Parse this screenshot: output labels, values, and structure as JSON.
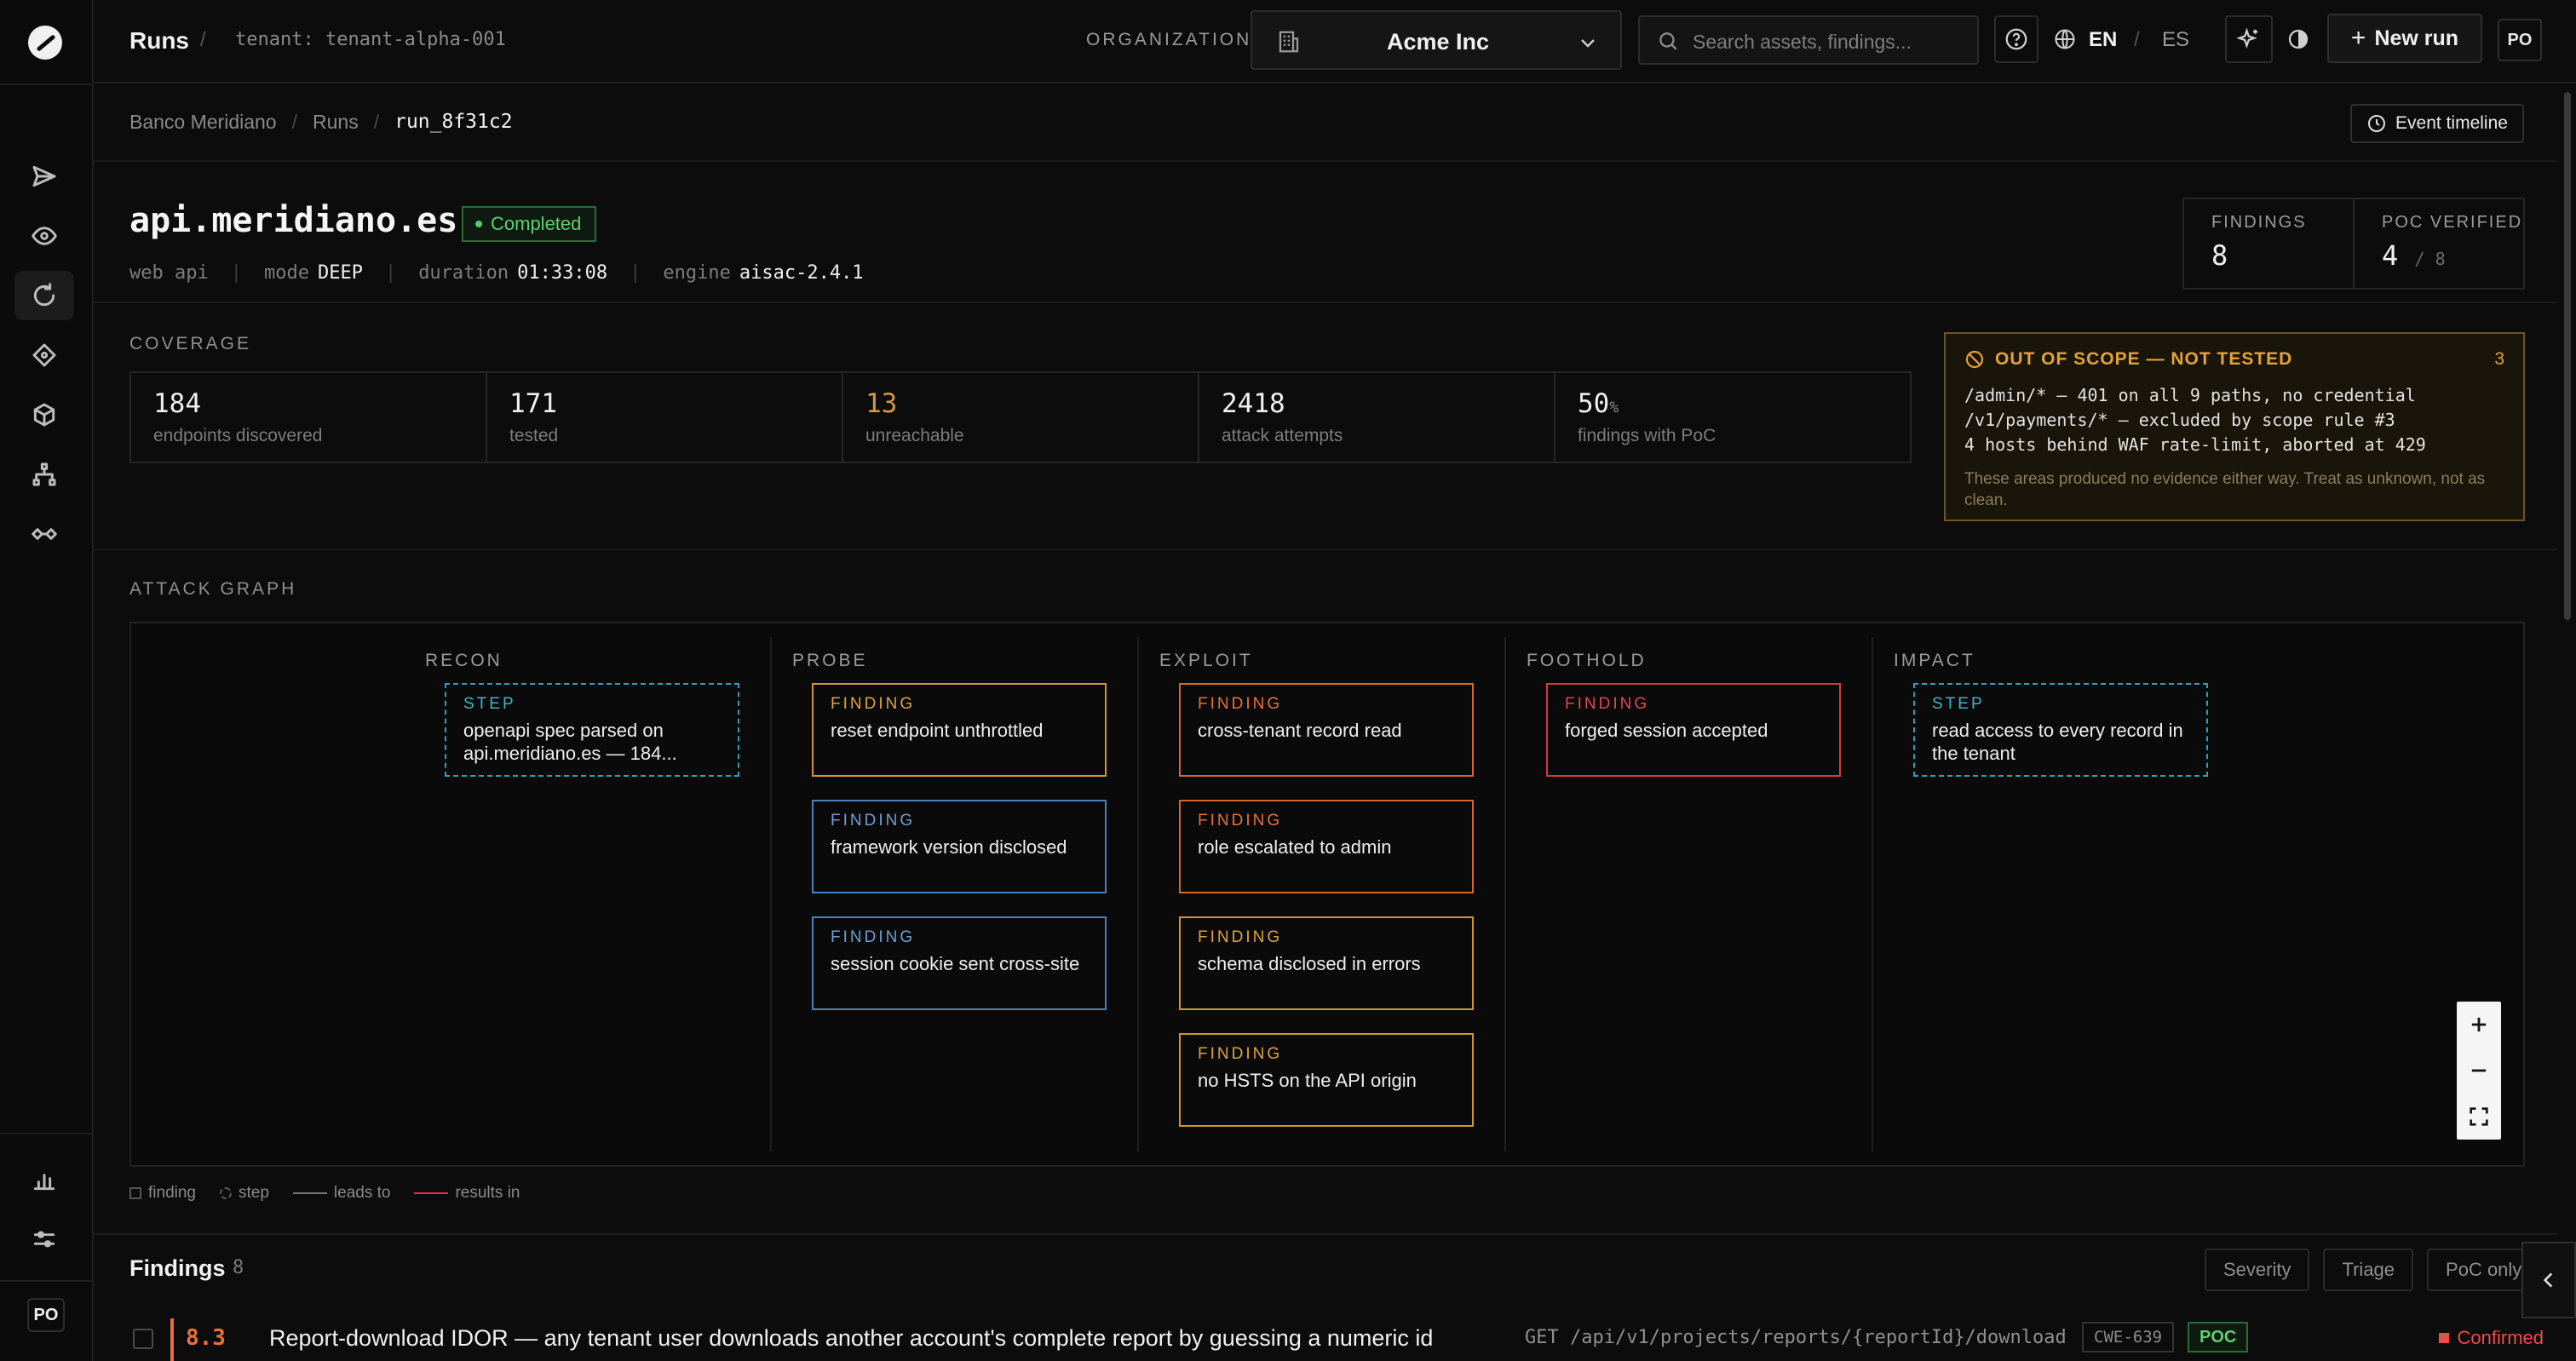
{
  "topbar": {
    "title": "Runs",
    "tenant": "tenant: tenant-alpha-001",
    "org_label": "ORGANIZATION",
    "org_name": "Acme Inc",
    "search_placeholder": "Search assets, findings...",
    "lang_active": "EN",
    "lang_other": "ES",
    "new_run_label": "New run",
    "avatar": "PO"
  },
  "rail": {
    "items": [
      "send-icon",
      "eye-icon",
      "refresh-icon",
      "diamond-icon",
      "cube-icon",
      "hierarchy-icon",
      "link-icon"
    ],
    "bottom": [
      "bar-chart-icon",
      "sliders-icon"
    ],
    "avatar": "PO",
    "active_index": 2
  },
  "breadcrumb": [
    "Banco Meridiano",
    "Runs",
    "run_8f31c2"
  ],
  "event_timeline_label": "Event timeline",
  "run": {
    "host": "api.meridiano.es",
    "status": "Completed",
    "meta": [
      {
        "label": "web api",
        "value": ""
      },
      {
        "label": "mode",
        "value": "DEEP"
      },
      {
        "label": "duration",
        "value": "01:33:08"
      },
      {
        "label": "engine",
        "value": "aisac-2.4.1"
      }
    ]
  },
  "kpis": {
    "findings_label": "FINDINGS",
    "findings_value": "8",
    "poc_label": "POC VERIFIED",
    "poc_value": "4",
    "poc_total": "/ 8"
  },
  "coverage": {
    "label": "COVERAGE",
    "cells": [
      {
        "value": "184",
        "caption": "endpoints discovered"
      },
      {
        "value": "171",
        "caption": "tested"
      },
      {
        "value": "13",
        "caption": "unreachable"
      },
      {
        "value": "2418",
        "caption": "attack attempts"
      },
      {
        "value": "50",
        "unit": "%",
        "caption": "findings with PoC"
      }
    ]
  },
  "out_of_scope": {
    "title": "OUT OF SCOPE — NOT TESTED",
    "count": "3",
    "lines": [
      "/admin/* — 401 on all 9 paths, no credential",
      "/v1/payments/* — excluded by scope rule #3",
      "4 hosts behind WAF rate-limit, aborted at 429"
    ],
    "note": "These areas produced no evidence either way. Treat as unknown, not as clean."
  },
  "attack_graph": {
    "label": "ATTACK GRAPH",
    "columns": [
      {
        "name": "RECON",
        "nodes": [
          {
            "kind": "STEP",
            "text": "openapi spec parsed on api.meridiano.es — 184...",
            "tone": "step"
          }
        ]
      },
      {
        "name": "PROBE",
        "nodes": [
          {
            "kind": "FINDING",
            "text": "reset endpoint unthrottled",
            "tone": "amber"
          },
          {
            "kind": "FINDING",
            "text": "framework version disclosed",
            "tone": "blue"
          },
          {
            "kind": "FINDING",
            "text": "session cookie sent cross-site",
            "tone": "blue"
          }
        ]
      },
      {
        "name": "EXPLOIT",
        "nodes": [
          {
            "kind": "FINDING",
            "text": "cross-tenant record read",
            "tone": "orange"
          },
          {
            "kind": "FINDING",
            "text": "role escalated to admin",
            "tone": "orange"
          },
          {
            "kind": "FINDING",
            "text": "schema disclosed in errors",
            "tone": "amber"
          },
          {
            "kind": "FINDING",
            "text": "no HSTS on the API origin",
            "tone": "amber"
          }
        ]
      },
      {
        "name": "FOOTHOLD",
        "nodes": [
          {
            "kind": "FINDING",
            "text": "forged session accepted",
            "tone": "red"
          }
        ]
      },
      {
        "name": "IMPACT",
        "nodes": [
          {
            "kind": "STEP",
            "text": "read access to every record in the tenant",
            "tone": "step"
          }
        ]
      }
    ],
    "legend": [
      "finding",
      "step",
      "leads to",
      "results in"
    ]
  },
  "findings": {
    "title": "Findings",
    "count": "8",
    "filters": [
      "Severity",
      "Triage",
      "PoC only"
    ],
    "rows": [
      {
        "severity": "8.3",
        "title": "Report-download IDOR — any tenant user downloads another account's complete report by guessing a numeric id",
        "endpoint": "GET /api/v1/projects/reports/{reportId}/download",
        "cwe": "CWE-639",
        "poc": "POC",
        "status": "Confirmed"
      }
    ]
  }
}
